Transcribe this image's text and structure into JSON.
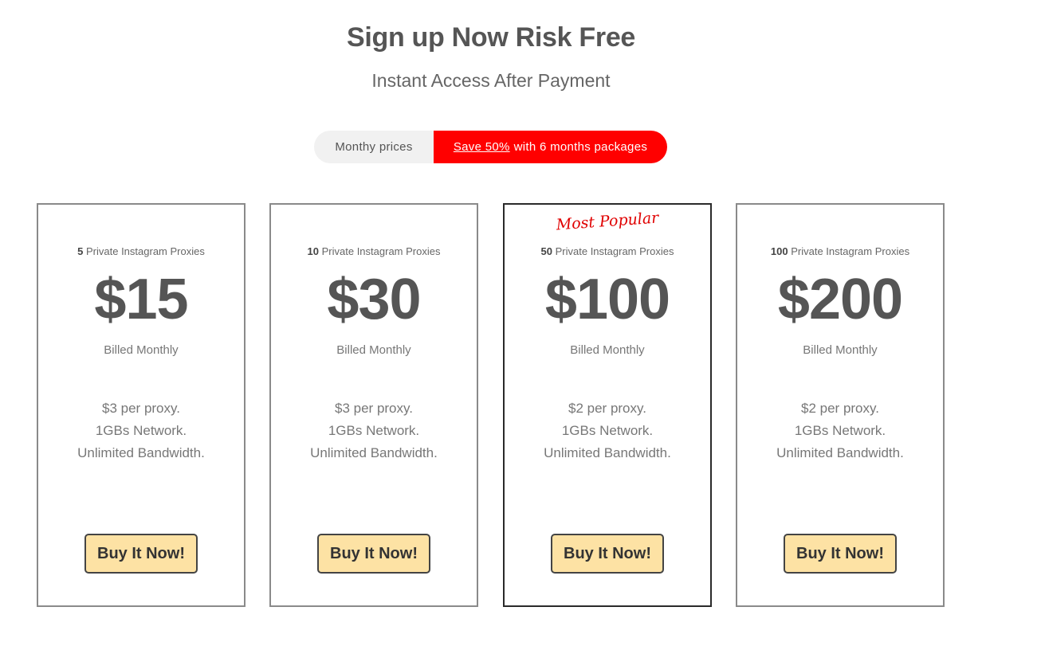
{
  "header": {
    "title": "Sign up Now Risk Free",
    "subtitle": "Instant Access After Payment"
  },
  "toggle": {
    "monthly_label": "Monthy prices",
    "save_highlight": "Save 50%",
    "save_rest": "with 6 months packages"
  },
  "colors": {
    "accent_red": "#ff0000",
    "button_bg": "#fde2a4",
    "text_gray": "#555555"
  },
  "plans": [
    {
      "count": "5",
      "count_suffix": "Private Instagram Proxies",
      "price": "$15",
      "billed": "Billed Monthly",
      "features": [
        "$3 per proxy.",
        "1GBs Network.",
        "Unlimited Bandwidth."
      ],
      "button": "Buy It Now!"
    },
    {
      "count": "10",
      "count_suffix": "Private Instagram Proxies",
      "price": "$30",
      "billed": "Billed Monthly",
      "features": [
        "$3 per proxy.",
        "1GBs Network.",
        "Unlimited Bandwidth."
      ],
      "button": "Buy It Now!"
    },
    {
      "tag": "Most Popular",
      "count": "50",
      "count_suffix": "Private Instagram Proxies",
      "price": "$100",
      "billed": "Billed Monthly",
      "features": [
        "$2 per proxy.",
        "1GBs Network.",
        "Unlimited Bandwidth."
      ],
      "button": "Buy It Now!"
    },
    {
      "count": "100",
      "count_suffix": "Private Instagram Proxies",
      "price": "$200",
      "billed": "Billed Monthly",
      "features": [
        "$2 per proxy.",
        "1GBs Network.",
        "Unlimited Bandwidth."
      ],
      "button": "Buy It Now!"
    }
  ]
}
